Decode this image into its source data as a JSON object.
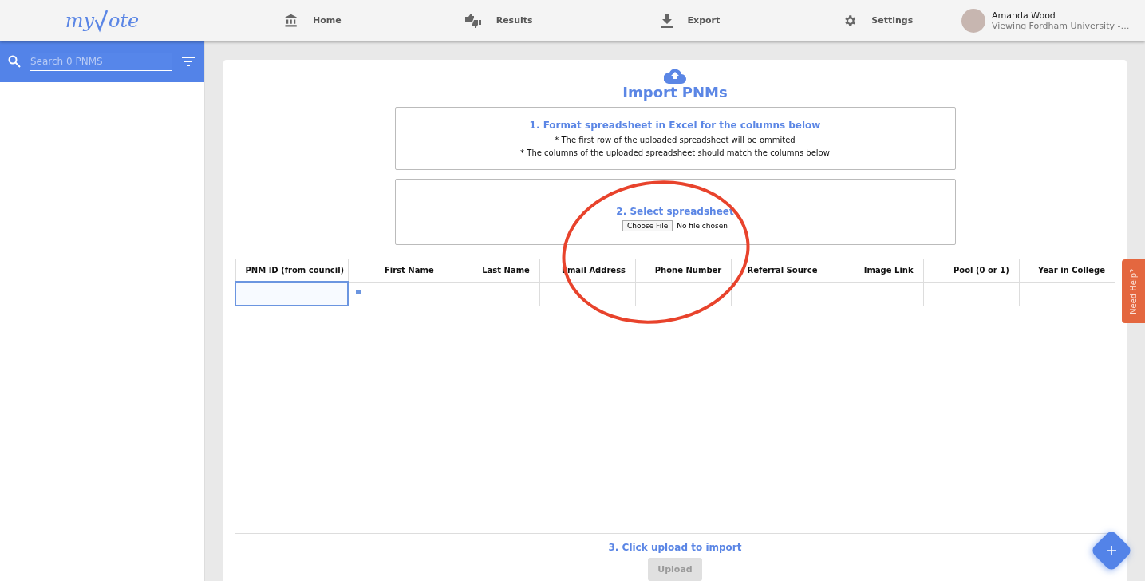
{
  "logo": {
    "prefix": "my",
    "suffix": "ote"
  },
  "nav": [
    {
      "kind": "bank",
      "label": "Home"
    },
    {
      "kind": "thumbs",
      "label": "Results"
    },
    {
      "kind": "download",
      "label": "Export"
    },
    {
      "kind": "gear",
      "label": "Settings"
    }
  ],
  "user": {
    "name": "Amanda Wood",
    "subtitle": "Viewing Fordham University -…"
  },
  "search": {
    "placeholder": "Search 0 PNMS"
  },
  "import": {
    "title": "Import PNMs",
    "step1": {
      "heading": "1. Format spreadsheet in Excel for the columns below",
      "notes": [
        "* The first row of the uploaded spreadsheet will be ommited",
        "* The columns of the uploaded spreadsheet should match the columns below"
      ]
    },
    "step2": {
      "heading": "2. Select spreadsheet",
      "file_button": "Choose File",
      "file_status": "No file chosen"
    },
    "table": {
      "columns": [
        "PNM ID (from council)",
        "First Name",
        "Last Name",
        "Email Address",
        "Phone Number",
        "Referral Source",
        "Image Link",
        "Pool (0 or 1)",
        "Year in College"
      ],
      "rows": [
        {
          "cells": [
            {
              "selected": true
            },
            {
              "selected": false
            },
            {
              "selected": false
            },
            {
              "selected": false
            },
            {
              "selected": false
            },
            {
              "selected": false
            },
            {
              "selected": false
            },
            {
              "selected": false
            },
            {
              "selected": false
            }
          ]
        }
      ]
    },
    "step3": {
      "heading": "3. Click upload to import",
      "button": {
        "label": "Upload",
        "disabled": true
      }
    }
  },
  "help_tab": {
    "label": "Need Help?"
  },
  "annotation": {
    "kind": "ellipse"
  }
}
